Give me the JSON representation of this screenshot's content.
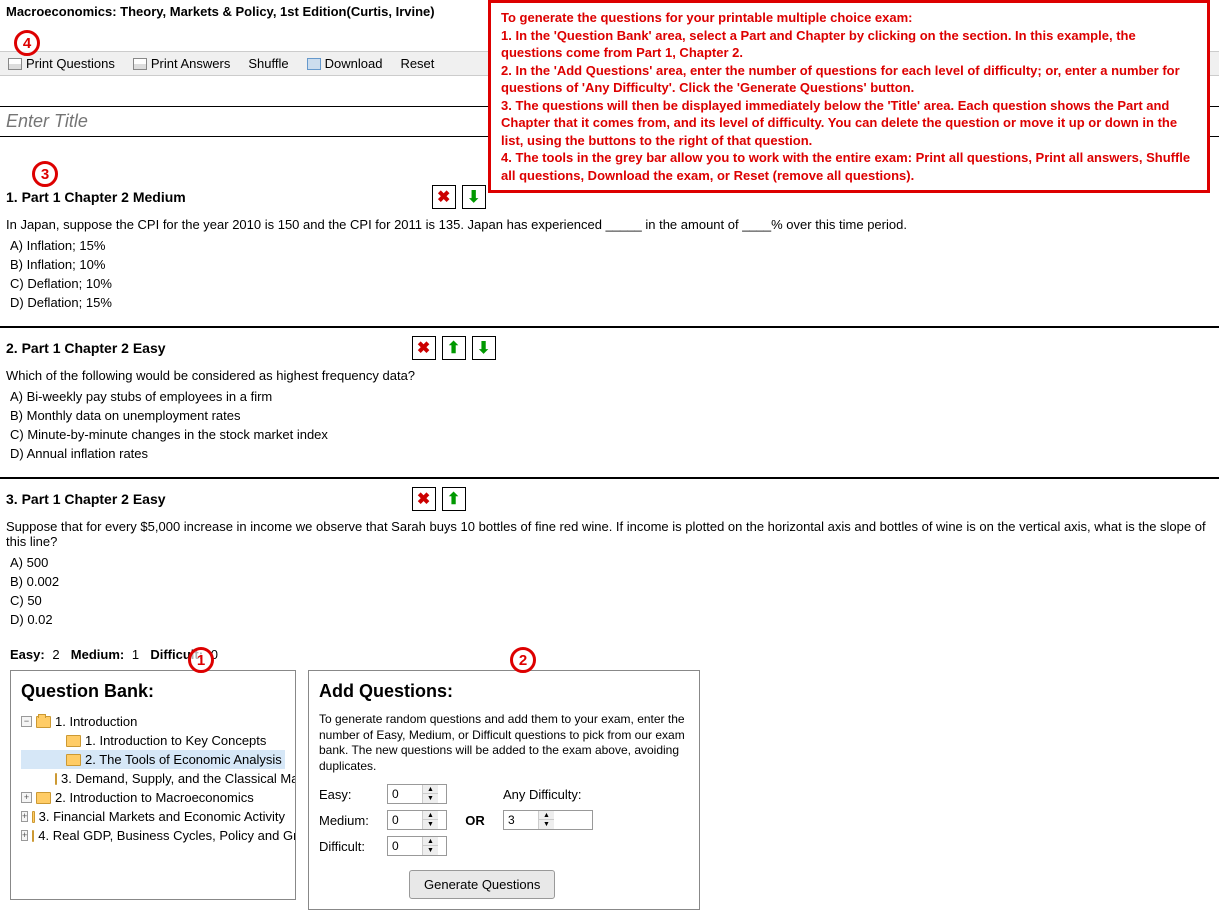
{
  "header": {
    "book_title": "Macroeconomics: Theory, Markets & Policy, 1st Edition(Curtis, Irvine)"
  },
  "toolbar": {
    "print_questions": "Print Questions",
    "print_answers": "Print Answers",
    "shuffle": "Shuffle",
    "download": "Download",
    "reset": "Reset"
  },
  "title_placeholder": "Enter Title",
  "instruction_box": "To generate the questions for your printable multiple choice exam:\n1. In the 'Question Bank' area, select a Part and Chapter by clicking on the section. In this example, the questions come from Part 1, Chapter 2.\n2. In the 'Add Questions' area, enter the number of questions for each level of difficulty; or, enter a number for questions of 'Any Difficulty'. Click the 'Generate Questions' button.\n3. The questions will then be displayed immediately below the 'Title' area. Each question shows the Part and Chapter that it comes from, and its level of difficulty. You can delete the question or move it up or down in the list, using the buttons to the right of that question.\n4. The tools in the grey bar allow you to work with the entire exam: Print all questions, Print all answers, Shuffle all questions, Download the exam, or Reset (remove all questions).",
  "markers": {
    "m1": "1",
    "m2": "2",
    "m3": "3",
    "m4": "4"
  },
  "questions": [
    {
      "header": "1. Part 1 Chapter 2 Medium",
      "text": "In Japan, suppose the CPI for the year 2010 is 150 and the CPI for 2011 is 135. Japan has experienced _____ in the amount of ____% over this time period.",
      "answers": [
        "A)  Inflation; 15%",
        "B)  Inflation; 10%",
        "C)  Deflation; 10%",
        "D)  Deflation; 15%"
      ],
      "has_up": false,
      "has_down": true
    },
    {
      "header": "2. Part 1 Chapter 2 Easy",
      "text": "Which of the following would be considered as highest frequency data?",
      "answers": [
        "A)  Bi-weekly pay stubs of employees in a firm",
        "B)  Monthly data on unemployment rates",
        "C)  Minute-by-minute changes in the stock market index",
        "D)  Annual inflation rates"
      ],
      "has_up": true,
      "has_down": true
    },
    {
      "header": "3. Part 1 Chapter 2 Easy",
      "text": "Suppose that for every $5,000 increase in income we observe that Sarah buys 10 bottles of fine red wine. If income is plotted on the horizontal axis and bottles of wine is on the vertical axis, what is the slope of this line?",
      "answers": [
        "A)  500",
        "B)  0.002",
        "C)  50",
        "D)  0.02"
      ],
      "has_up": true,
      "has_down": false
    }
  ],
  "summary": {
    "easy_label": "Easy:",
    "easy": "2",
    "medium_label": "Medium:",
    "medium": "1",
    "difficult_label": "Difficult:",
    "difficult": "0"
  },
  "qbank": {
    "title": "Question Bank:",
    "items": [
      {
        "label": "1. Introduction",
        "indent": 0,
        "toggle": "−",
        "open": true
      },
      {
        "label": "1. Introduction to Key Concepts",
        "indent": 1,
        "toggle": ""
      },
      {
        "label": "2. The Tools of Economic Analysis",
        "indent": 1,
        "toggle": "",
        "selected": true
      },
      {
        "label": "3. Demand, Supply, and the Classical Ma",
        "indent": 1,
        "toggle": ""
      },
      {
        "label": "2. Introduction to Macroeconomics",
        "indent": 0,
        "toggle": "+"
      },
      {
        "label": "3. Financial Markets and Economic Activity",
        "indent": 0,
        "toggle": "+"
      },
      {
        "label": "4. Real GDP, Business Cycles, Policy and Gr",
        "indent": 0,
        "toggle": "+"
      }
    ]
  },
  "addq": {
    "title": "Add Questions:",
    "desc": "To generate random questions and add them to your exam, enter the number of Easy, Medium, or Difficult questions to pick from our exam bank. The new questions will be added to the exam above, avoiding duplicates.",
    "labels": {
      "easy": "Easy:",
      "medium": "Medium:",
      "difficult": "Difficult:",
      "any": "Any Difficulty:",
      "or": "OR"
    },
    "values": {
      "easy": "0",
      "medium": "0",
      "difficult": "0",
      "any": "3"
    },
    "generate_btn": "Generate Questions"
  }
}
